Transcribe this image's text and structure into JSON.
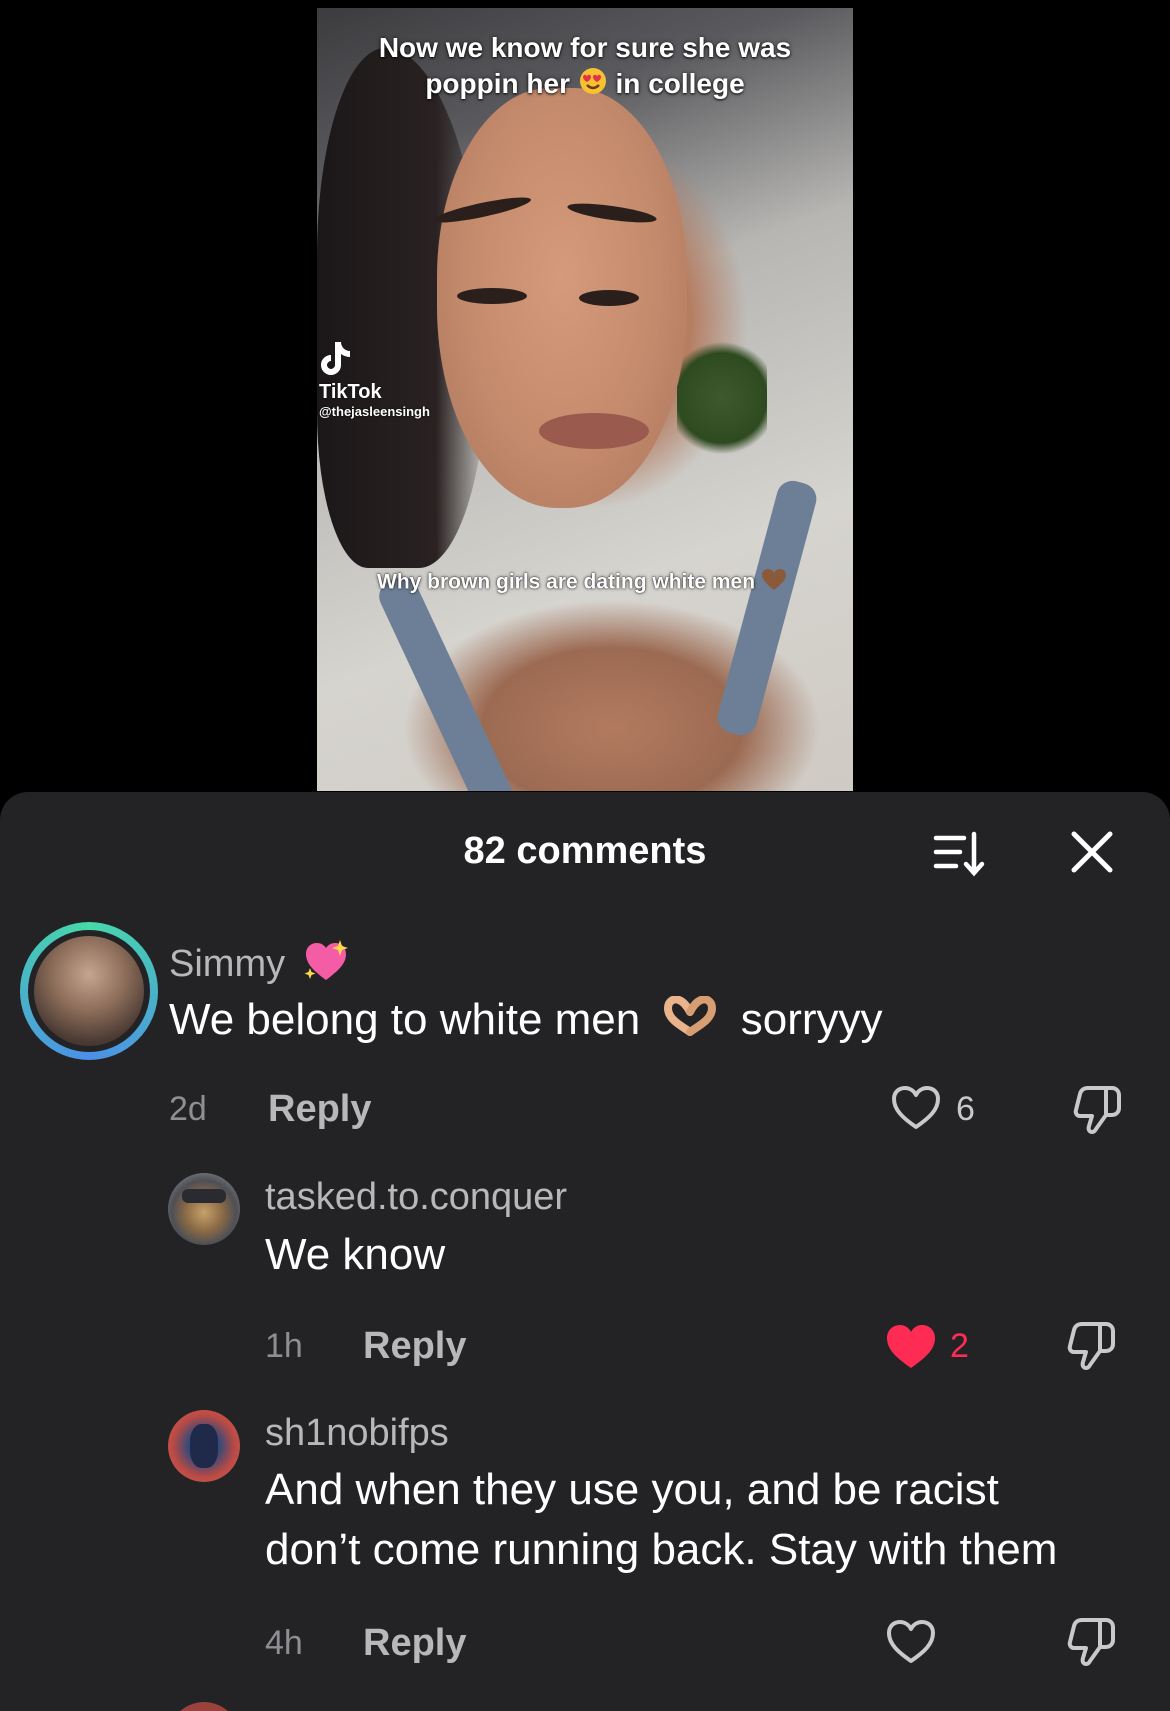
{
  "video": {
    "caption_top_line1": "Now we know for sure she was",
    "caption_top_line2_pre": "poppin her",
    "caption_top_line2_post": "in college",
    "caption_mid": "Why brown girls are dating white men",
    "tiktok_wordmark": "TikTok",
    "tiktok_handle": "@thejasleensingh"
  },
  "panel": {
    "title": "82 comments",
    "sort_icon": "sort-icon",
    "close_icon": "close-icon"
  },
  "comments": [
    {
      "username": "Simmy",
      "username_emoji": "sparkling-heart",
      "text_pre": "We belong to white men",
      "text_emoji": "heart-hands",
      "text_post": "sorryyy",
      "time": "2d",
      "reply_label": "Reply",
      "likes": "6",
      "liked": false
    },
    {
      "username": "tasked.to.conquer",
      "text": "We know",
      "time": "1h",
      "reply_label": "Reply",
      "likes": "2",
      "liked": true
    },
    {
      "username": "sh1nobifps",
      "text_line1": "And when they use you, and be racist",
      "text_line2": "don’t come running back. Stay with them",
      "time": "4h",
      "reply_label": "Reply",
      "likes": "",
      "liked": false
    }
  ],
  "colors": {
    "panel_bg": "#232325",
    "liked_heart": "#fe2c55",
    "story_ring_start": "#47d9a8",
    "story_ring_end": "#4b8fe8"
  }
}
